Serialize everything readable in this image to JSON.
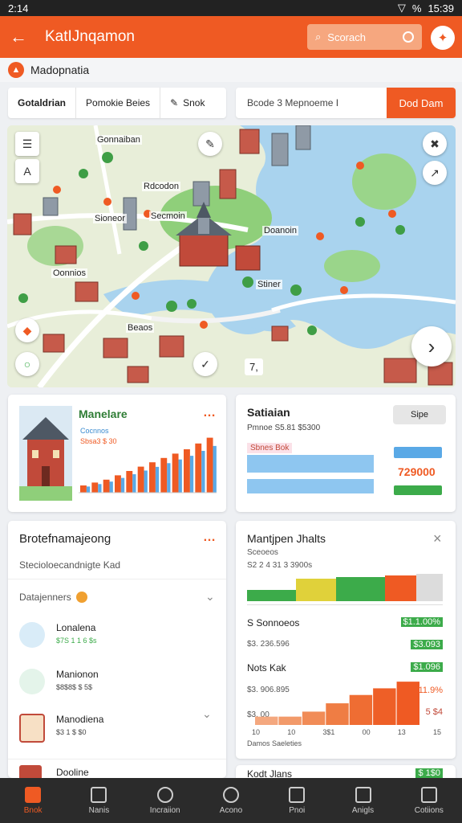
{
  "status": {
    "time": "2:14",
    "battery": "%",
    "clock": "15:39"
  },
  "appbar": {
    "title": "KatIJnqamon",
    "search_label": "Scorach"
  },
  "location": {
    "label": "Madopnatia"
  },
  "filters": [
    {
      "label": "Gotaldrian"
    },
    {
      "label": "Pomokie Beies"
    },
    {
      "label": "Snok"
    }
  ],
  "search": {
    "value": "Bcode 3  Mepnoeme  I",
    "button": "Dod Dam"
  },
  "map": {
    "labels": [
      "Gonnaiban",
      "Rdcodon",
      "Sioneor",
      "Secmoin",
      "Doanoin",
      "Oonnios",
      "Stiner",
      "Beaos",
      "7,"
    ]
  },
  "card1": {
    "title": "Manelare",
    "sub": "Cocnnos",
    "value": "Sbsa3 $ 30",
    "chart_values": [
      10,
      14,
      18,
      24,
      30,
      36,
      42,
      48,
      54,
      60,
      68,
      76
    ]
  },
  "card2": {
    "title": "Satiaian",
    "line1": "Pmnoe S5.81 $5300",
    "tag": "Sbnes Bok",
    "button": "Sipe",
    "value": "729000",
    "bars": [
      72,
      60,
      44,
      28
    ]
  },
  "card3": {
    "title": "Brotefnamajeong",
    "subtitle": "Stecioloecandnigte Kad",
    "section": "Datajenners",
    "items": [
      {
        "title": "Lonalena",
        "meta": "$7S 1 1 6 $s"
      },
      {
        "title": "Manionon",
        "meta": "$8$8$ $ 5$"
      },
      {
        "title": "Manodiena",
        "meta": "$3 1 $ $0"
      },
      {
        "title": "Dooline",
        "meta": ""
      }
    ]
  },
  "card4": {
    "title": "Mantjpen Jhalts",
    "line1": "Sceoeos",
    "line2": "S2 2 4 31 3 3900s",
    "stacked": [
      {
        "color": "#3cab4a",
        "value": 22
      },
      {
        "color": "#e0d13a",
        "value": 18
      },
      {
        "color": "#3cab4a",
        "value": 22
      },
      {
        "color": "#ef5a23",
        "value": 14
      },
      {
        "color": "#dcdcdc",
        "value": 12
      }
    ],
    "rows": [
      {
        "label": "S Sonnoeos",
        "value": "$1.1.00%"
      },
      {
        "label": "$3. 236.596",
        "value": "$3.093"
      },
      {
        "label": "Nots Kak",
        "value": "$1.096"
      },
      {
        "label": "$3. 906.895",
        "value": "11.9%"
      },
      {
        "label": "$3. 00",
        "value": "5 $4"
      }
    ],
    "axis": [
      "10",
      "10",
      "3$1",
      "00",
      "13",
      "15"
    ],
    "footer": "Damos Saeleties",
    "bottom_label": "Kodt Jlans",
    "bottom_value": "$ 1$0",
    "chart_values": [
      10,
      10,
      16,
      26,
      36,
      44,
      52
    ]
  },
  "nav": [
    {
      "label": "Bnok"
    },
    {
      "label": "Nanis"
    },
    {
      "label": "Incraiion"
    },
    {
      "label": "Acono"
    },
    {
      "label": "Pnoi"
    },
    {
      "label": "Anigls"
    },
    {
      "label": "Cotiions"
    }
  ],
  "colors": {
    "accent": "#ef5a23",
    "green": "#3cab4a",
    "blue": "#5aa9e6",
    "yellow": "#e0d13a"
  }
}
